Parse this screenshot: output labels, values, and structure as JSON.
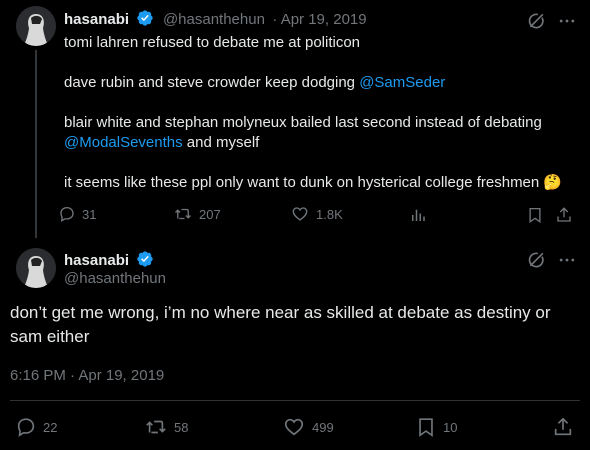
{
  "tweet1": {
    "display_name": "hasanabi",
    "handle": "@hasanthehun",
    "date": "· Apr 19, 2019",
    "lines": {
      "l1": "tomi lahren refused to debate me at politicon",
      "l2a": "dave rubin and steve crowder keep dodging ",
      "l2m": "@SamSeder",
      "l3": "blair white and stephan molyneux bailed last second instead of debating",
      "l4m": "@ModalSevenths",
      "l4b": " and myself",
      "l5": "it seems like these ppl only want to dunk on hysterical college freshmen",
      "emoji": "🤔"
    },
    "replies": "31",
    "retweets": "207",
    "likes": "1.8K"
  },
  "tweet2": {
    "display_name": "hasanabi",
    "handle": "@hasanthehun",
    "text": "don’t get me wrong, i’m no where near as skilled at debate as destiny or sam either",
    "timestamp": "6:16 PM · Apr 19, 2019",
    "replies": "22",
    "retweets": "58",
    "likes": "499",
    "bookmarks": "10"
  },
  "colors": {
    "accent": "#1d9bf0",
    "muted": "#71767b",
    "text": "#e7e9ea",
    "background": "#000000"
  },
  "icons": [
    "grok-icon",
    "more-icon",
    "verified-badge-icon",
    "reply-icon",
    "retweet-icon",
    "like-icon",
    "views-icon",
    "bookmark-icon",
    "share-icon"
  ]
}
